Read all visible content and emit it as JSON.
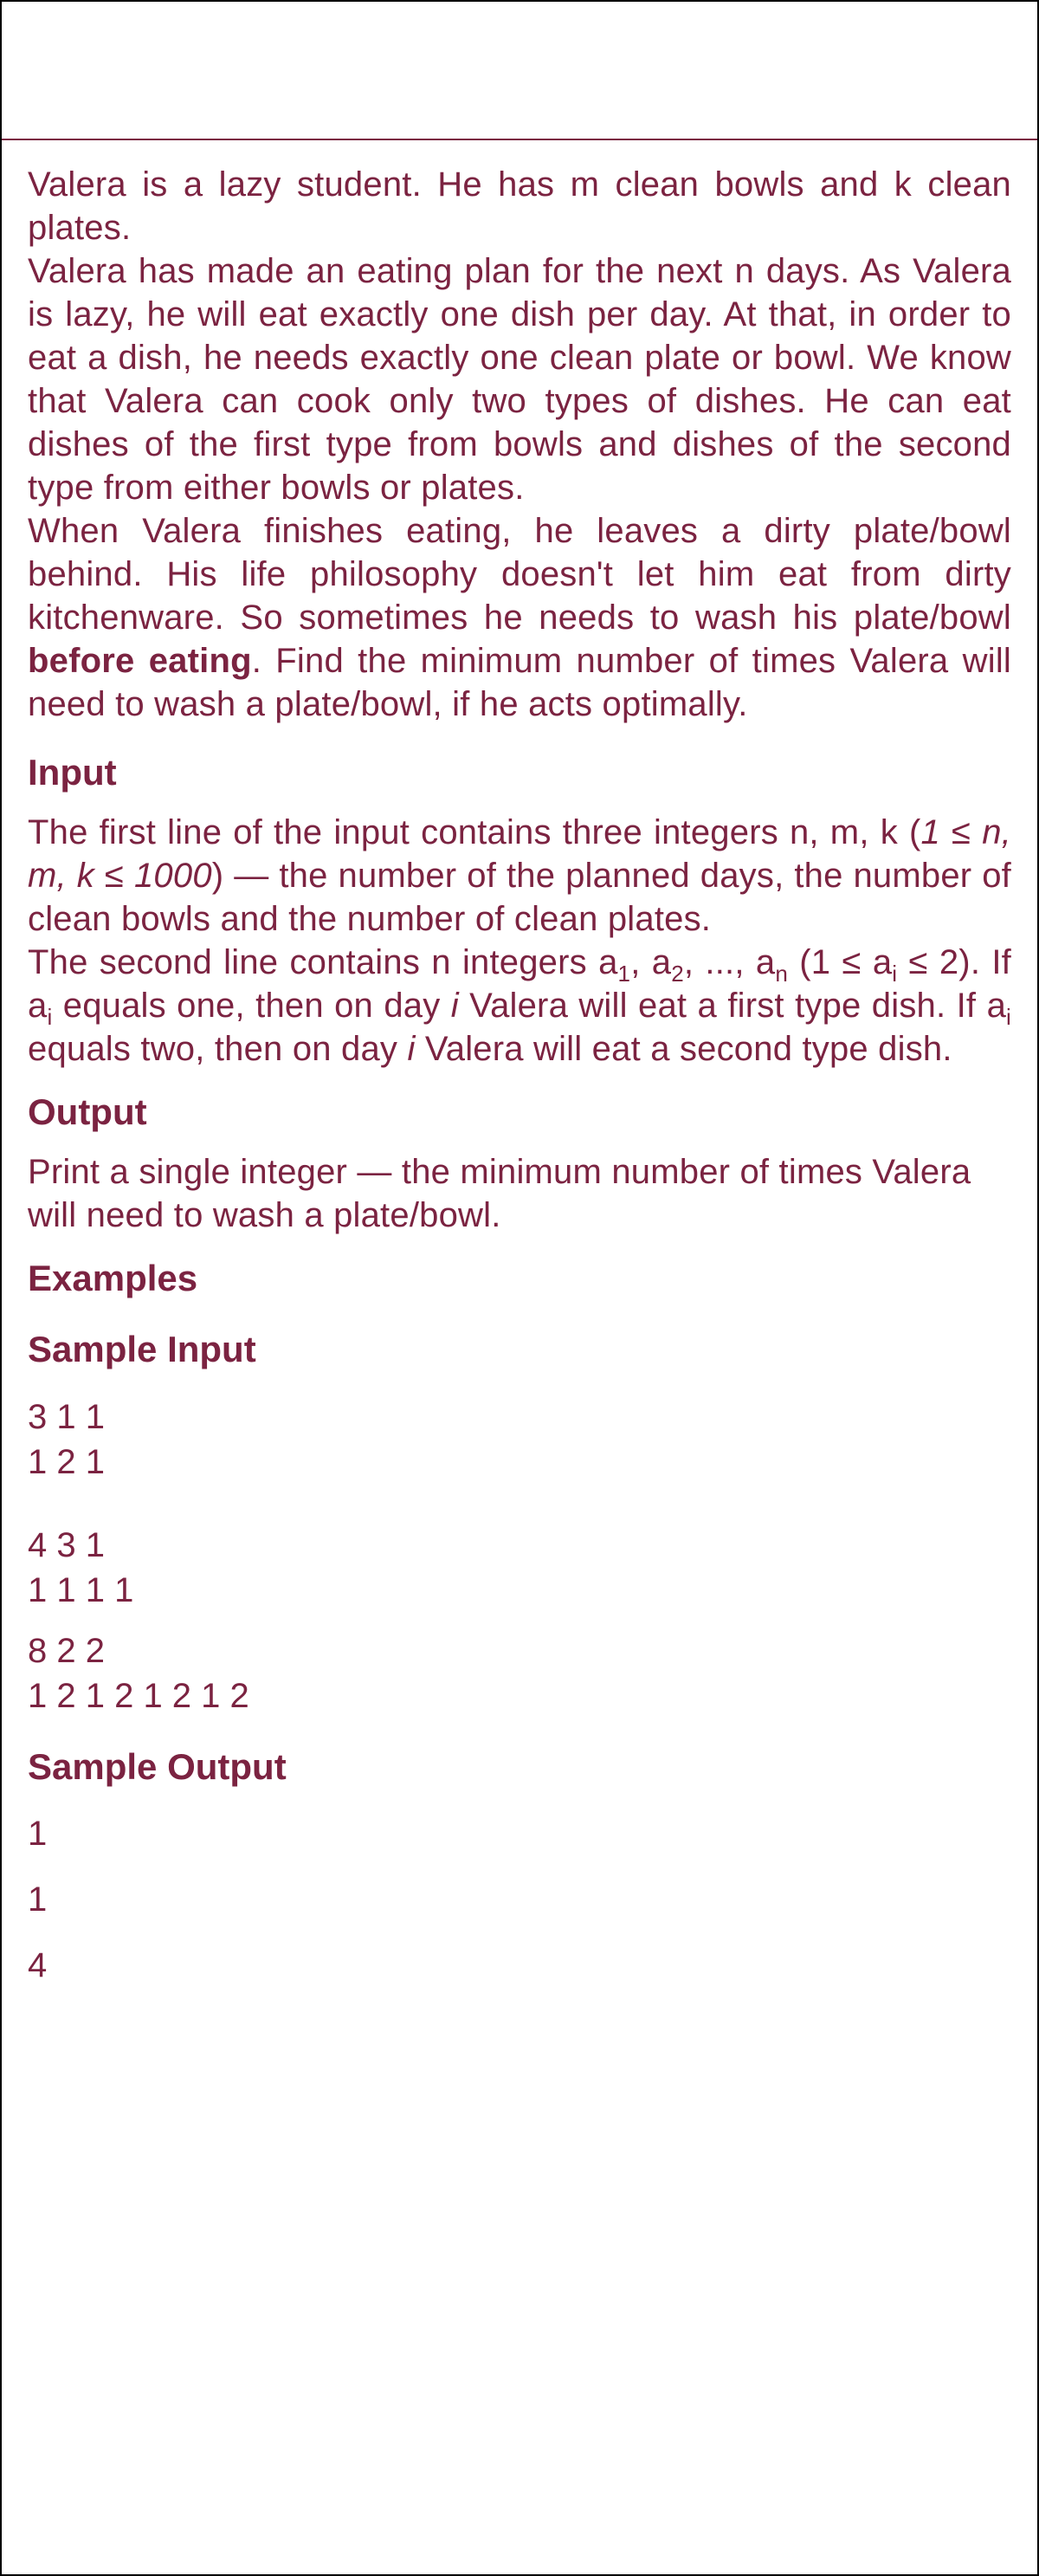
{
  "statement": {
    "p1": "Valera is a lazy student. He has m clean bowls and k clean plates.",
    "p2": "Valera has made an eating plan for the next n days. As Valera is lazy, he will eat exactly one dish per day. At that, in order to eat a dish, he needs exactly one clean plate or bowl. We know that Valera can cook only two types of dishes. He can eat dishes of the first type from bowls and dishes of the second type from either bowls or plates.",
    "p3_before": "When Valera finishes eating, he leaves a dirty plate/bowl behind. His life philosophy doesn't let him eat from dirty kitchenware. So sometimes he needs to wash his plate/bowl ",
    "p3_bold": "before eating",
    "p3_after": ". Find the minimum number of times Valera will need to wash a plate/bowl, if he acts optimally."
  },
  "input": {
    "title": "Input",
    "l1_a": "The first line of the input contains three integers n, m, k (",
    "l1_italic": "1 ≤ n, m, k ≤ 1000",
    "l1_b": ") — the number of the planned days, the number of clean bowls and the number of clean plates.",
    "l2_a": "The second line contains n integers a",
    "sub1": "1",
    "l2_b": ", a",
    "sub2": "2",
    "l2_c": ", ..., a",
    "subn": "n",
    "l2_d": " (1 ≤ a",
    "subi1": "i",
    "l2_e": " ≤ 2). If a",
    "subi2": "i",
    "l2_f": " equals one, then on day ",
    "i1": "i",
    "l2_g": " Valera will eat a first type dish. If a",
    "subi3": "i",
    "l2_h": " equals two, then on day ",
    "i2": "i",
    "l2_i": " Valera will eat a second type dish."
  },
  "output": {
    "title": "Output",
    "text": "Print a single integer — the minimum number of times Valera will need to wash a plate/bowl."
  },
  "examples": {
    "title": "Examples",
    "sample_input_title": "Sample Input",
    "inputs": [
      [
        "3 1 1",
        "1 2 1"
      ],
      [
        "4 3 1",
        "1 1 1 1"
      ],
      [
        "8 2 2",
        "1 2 1 2 1 2 1 2"
      ]
    ],
    "sample_output_title": "Sample Output",
    "outputs": [
      "1",
      "1",
      "4"
    ]
  }
}
